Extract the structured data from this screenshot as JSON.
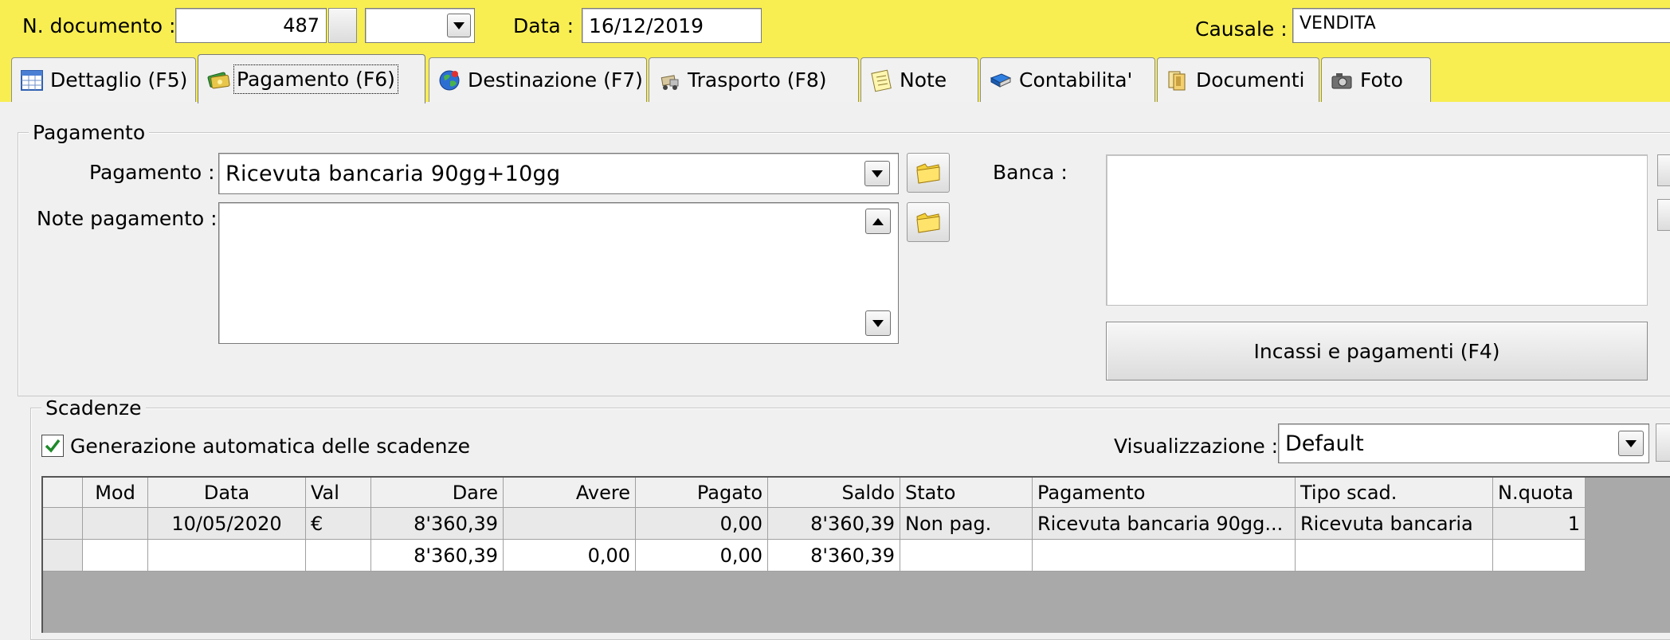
{
  "header": {
    "doc_number_label": "N. documento :",
    "doc_number_value": "487",
    "date_label": "Data :",
    "date_value": "16/12/2019",
    "causale_label": "Causale :",
    "causale_value": "VENDITA"
  },
  "tabs": [
    {
      "label": "Dettaglio (F5)",
      "icon": "grid-table-icon"
    },
    {
      "label": "Pagamento (F6)",
      "icon": "money-icon",
      "active": true
    },
    {
      "label": "Destinazione (F7)",
      "icon": "globe-icon"
    },
    {
      "label": "Trasporto (F8)",
      "icon": "truck-icon"
    },
    {
      "label": "Note",
      "icon": "notepad-icon"
    },
    {
      "label": "Contabilita'",
      "icon": "book-icon"
    },
    {
      "label": "Documenti",
      "icon": "documents-icon"
    },
    {
      "label": "Foto",
      "icon": "camera-icon"
    }
  ],
  "payment": {
    "group_title": "Pagamento",
    "payment_label": "Pagamento :",
    "payment_value": "Ricevuta bancaria 90gg+10gg",
    "notes_label": "Note pagamento :",
    "notes_value": "",
    "bank_label": "Banca :",
    "bank_value": "",
    "incassi_button": "Incassi e pagamenti (F4)"
  },
  "scadenze": {
    "group_title": "Scadenze",
    "auto_generate_label": "Generazione automatica delle scadenze",
    "auto_generate_checked": true,
    "view_label": "Visualizzazione :",
    "view_value": "Default",
    "columns": [
      "",
      "Mod",
      "Data",
      "Val",
      "Dare",
      "Avere",
      "Pagato",
      "Saldo",
      "Stato",
      "Pagamento",
      "Tipo scad.",
      "N.quota"
    ],
    "rows": [
      [
        "",
        "",
        "10/05/2020",
        "€",
        "8'360,39",
        "",
        "0,00",
        "8'360,39",
        "Non pag.",
        "Ricevuta bancaria 90gg...",
        "Ricevuta bancaria",
        "1"
      ],
      [
        "",
        "",
        "",
        "",
        "8'360,39",
        "0,00",
        "0,00",
        "8'360,39",
        "",
        "",
        "",
        ""
      ]
    ]
  },
  "colors": {
    "top_bar": "#f8ee52",
    "window_bg": "#f0f0f0",
    "grid_bg": "#a9a9a9",
    "check_green": "#1e8a2a"
  }
}
